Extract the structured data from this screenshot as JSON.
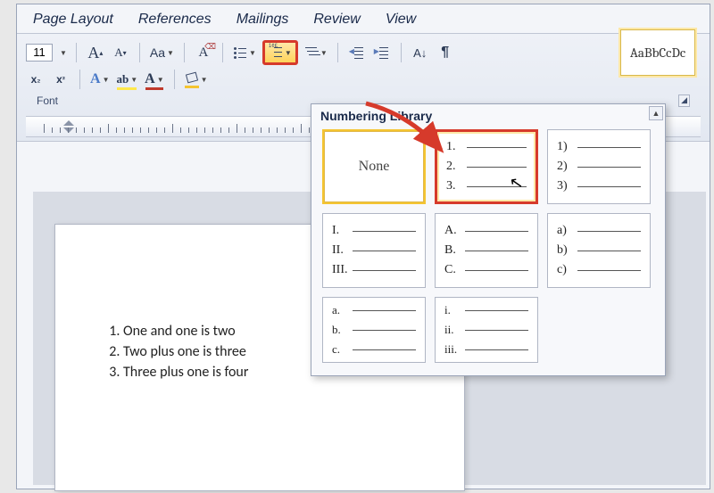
{
  "tabs": [
    "Page Layout",
    "References",
    "Mailings",
    "Review",
    "View"
  ],
  "ribbon": {
    "font_size": "11",
    "grow_font": "A",
    "shrink_font": "A",
    "change_case": "Aa",
    "clear_formatting": "A",
    "subscript": "x",
    "superscript": "x",
    "font_color_glyph": "A",
    "highlight_glyph": "ab",
    "text_color_glyph": "A",
    "sort_glyph": "A↓",
    "pilcrow": "¶",
    "style_swatch": "AaBbCcDc",
    "group_label": "Font"
  },
  "numlib": {
    "title": "Numbering Library",
    "cells": {
      "none": "None",
      "decimal_dot": [
        "1.",
        "2.",
        "3."
      ],
      "decimal_paren": [
        "1)",
        "2)",
        "3)"
      ],
      "upper_roman": [
        "I.",
        "II.",
        "III."
      ],
      "upper_alpha": [
        "A.",
        "B.",
        "C."
      ],
      "lower_alpha_paren": [
        "a)",
        "b)",
        "c)"
      ],
      "lower_alpha_dot": [
        "a.",
        "b.",
        "c."
      ],
      "lower_roman": [
        "i.",
        "ii.",
        "iii."
      ]
    }
  },
  "document": {
    "items": [
      "One and one is two",
      "Two plus one is three",
      "Three plus one is four"
    ]
  }
}
